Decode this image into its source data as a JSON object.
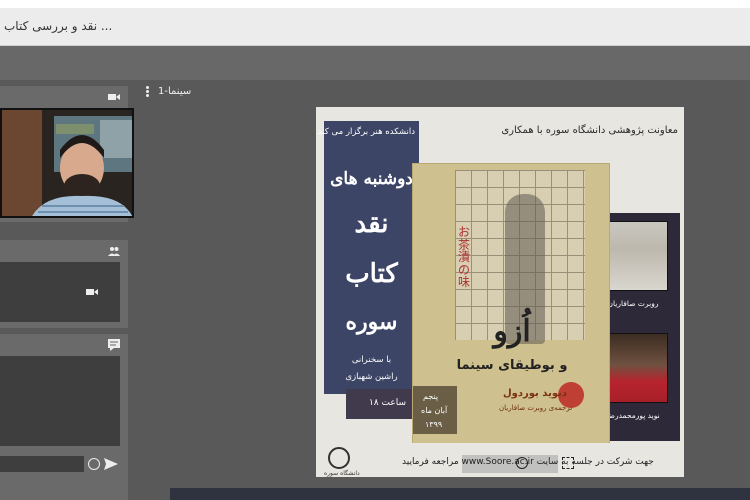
{
  "window": {
    "title": "نقد و بررسی کتاب ..."
  },
  "sidebar": {
    "video_icon": "video-camera-icon",
    "users_icon": "users-icon",
    "users_box_icon": "video-camera-icon",
    "chat_icon": "chat-icon",
    "chat_emoji_icon": "emoji-icon",
    "chat_send_icon": "send-icon"
  },
  "presentation": {
    "title": "سینما-1",
    "menu_icon": "kebab-menu-icon"
  },
  "poster": {
    "top_line": "معاونت پژوهشی دانشگاه سوره با همکاری",
    "org_line": "دانشکده هنر برگزار می کند",
    "word1": "دوشنبه های",
    "word2": "نقد",
    "word3": "کتاب",
    "word4": "سوره",
    "with_line": "با سخنرانی",
    "speaker": "راشین شهبازی",
    "hour": "ساعت ۱۸",
    "person1": "روبرت صافاریان",
    "person2": "نوید پورمحمدرضا",
    "book_jp": "お茶漬の味",
    "book_title": "اُزو",
    "book_subtitle": "و بوطیقای سینما",
    "book_author": "دیوید بوردول",
    "book_translator": "ترجمه‌ی روبرت صافاریان",
    "date_day": "پنجم",
    "date_month": "آبان ماه",
    "date_year": "۱۳۹۹",
    "footer_text": "جهت شرکت در جلسه به سایت www.Soore.ac.ir مراجعه فرمایید",
    "footer_logo_text": "دانشگاه سوره",
    "zoom_icon": "zoom-icon",
    "fullscreen_icon": "fullscreen-icon"
  }
}
